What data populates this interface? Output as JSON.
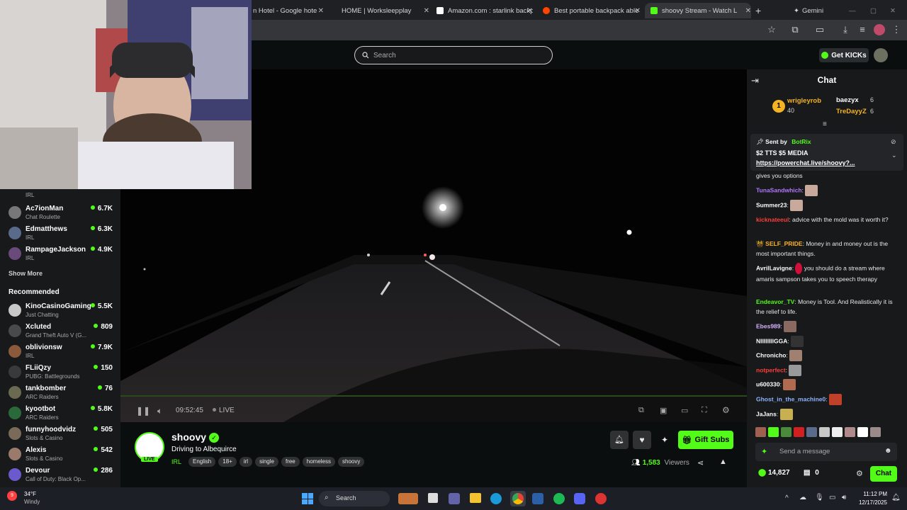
{
  "browser": {
    "tabs": [
      {
        "label": "n Hotel - Google hote"
      },
      {
        "label": "HOME | Worksleepplay"
      },
      {
        "label": "Amazon.com : starlink backp"
      },
      {
        "label": "Best portable backpack able"
      },
      {
        "label": "shoovy Stream - Watch L"
      }
    ],
    "gemini_label": "Gemini",
    "new_tab": "+"
  },
  "header": {
    "search_placeholder": "Search",
    "get_kicks": "Get KICKs"
  },
  "sidebar": {
    "top_partial": {
      "category": "IRL"
    },
    "following": [
      {
        "name": "Ac7ionMan",
        "category": "Chat Roulette",
        "viewers": "6.7K"
      },
      {
        "name": "Edmatthews",
        "category": "IRL",
        "viewers": "6.3K"
      },
      {
        "name": "RampageJackson",
        "category": "IRL",
        "viewers": "4.9K"
      }
    ],
    "show_more": "Show More",
    "recommended_title": "Recommended",
    "recommended": [
      {
        "name": "KinoCasinoGaming",
        "category": "Just Chatting",
        "viewers": "5.5K"
      },
      {
        "name": "Xcluted",
        "category": "Grand Theft Auto V (G...",
        "viewers": "809"
      },
      {
        "name": "oblivionsw",
        "category": "IRL",
        "viewers": "7.9K"
      },
      {
        "name": "FLiiQzy",
        "category": "PUBG: Battlegrounds",
        "viewers": "150"
      },
      {
        "name": "tankbomber",
        "category": "ARC Raiders",
        "viewers": "76"
      },
      {
        "name": "kyootbot",
        "category": "ARC Raiders",
        "viewers": "5.8K"
      },
      {
        "name": "funnyhoodvidz",
        "category": "Slots & Casino",
        "viewers": "505"
      },
      {
        "name": "Alexis",
        "category": "Slots & Casino",
        "viewers": "542"
      },
      {
        "name": "Devour",
        "category": "Call of Duty: Black Op...",
        "viewers": "286"
      }
    ]
  },
  "player": {
    "time": "09:52:45",
    "live_label": "LIVE"
  },
  "stream": {
    "streamer": "shoovy",
    "live_badge": "LIVE",
    "title": "Driving to Albequirce",
    "category": "IRL",
    "tags": [
      "English",
      "18+",
      "irl",
      "single",
      "free",
      "homeless",
      "shoovy"
    ],
    "viewers": "1,583",
    "viewers_label": "Viewers",
    "gift_subs": "Gift Subs"
  },
  "chat": {
    "title": "Chat",
    "leaderboard": {
      "first": {
        "rank": "1",
        "name": "wrigleyrob",
        "count": "40"
      },
      "second": {
        "name": "baezyx",
        "count": "6"
      },
      "third": {
        "name": "TreDayyZ",
        "count": "6"
      }
    },
    "pinned": {
      "sent_by": "Sent by",
      "bot": "BotRix",
      "line1": "$2 TTS $5 MEDIA",
      "link": "https://powerchat.live/shoovy?..."
    },
    "partial_line": "gives you options",
    "messages": [
      {
        "user": "TunaSandwhich",
        "text": "",
        "color": "#b278ff"
      },
      {
        "user": "Summer23",
        "text": "",
        "color": "#ffffff"
      },
      {
        "user": "kicknateeul",
        "text": "advice with the mold was it worth it?",
        "color": "#ff3d3d"
      },
      {
        "user": "SELF_PRIDE",
        "text": "Money in and money out is the most important things.",
        "color": "#ffb020"
      },
      {
        "user": "AvrilLavigne",
        "text": "you should do a stream where amaris sampson takes you to speech therapy",
        "color": "#ffffff"
      },
      {
        "user": "Endeavor_TV",
        "text": "Money is Tool. And Realistically it is the relief to life.",
        "color": "#53fc18"
      },
      {
        "user": "Ebes989",
        "text": "",
        "color": "#d7b3ff"
      },
      {
        "user": "NIIIIIIIIGGA",
        "text": "",
        "color": "#ffffff"
      },
      {
        "user": "Chronicho",
        "text": "",
        "color": "#ffffff"
      },
      {
        "user": "notperfect",
        "text": "",
        "color": "#ff3d3d"
      },
      {
        "user": "u600330",
        "text": "",
        "color": "#ffffff"
      },
      {
        "user": "Ghost_in_the_machine0",
        "text": "",
        "color": "#8fb4ff"
      },
      {
        "user": "JaJans",
        "text": "",
        "color": "#ffffff"
      }
    ],
    "input_placeholder": "Send a message",
    "points": "14,827",
    "items": "0",
    "chat_button": "Chat"
  },
  "taskbar": {
    "weather_temp": "34°F",
    "weather_desc": "Windy",
    "search": "Search",
    "time": "11:12 PM",
    "date": "12/17/2025",
    "badge": "9"
  },
  "colors": {
    "kick_green": "#53fc18",
    "background": "#0b0e0f",
    "panel": "#18191b"
  }
}
